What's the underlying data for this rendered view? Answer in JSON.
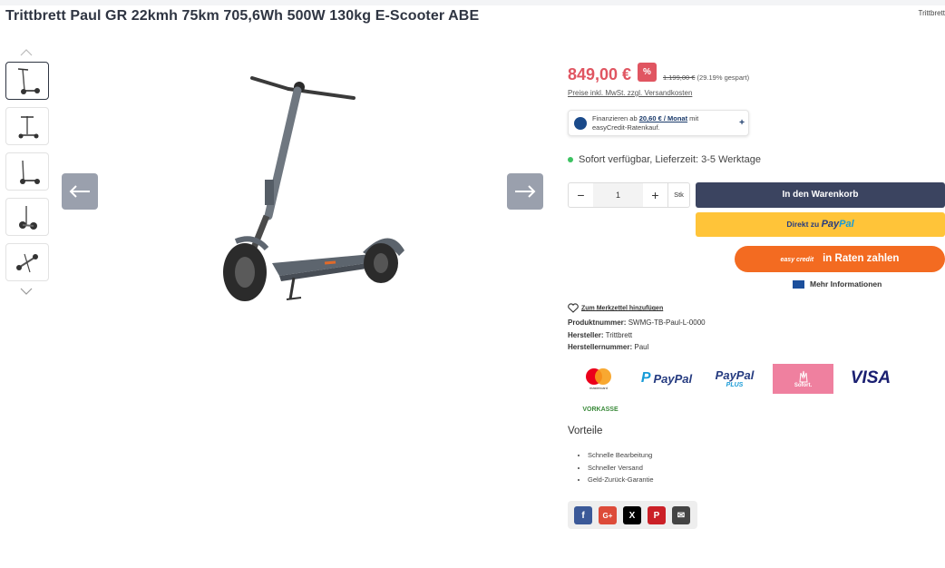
{
  "page": {
    "title": "Trittbrett Paul GR 22kmh 75km 705,6Wh 500W 130kg E-Scooter ABE",
    "brand_top": "Trittbrett"
  },
  "gallery": {
    "thumbnails": [
      "thumb-1",
      "thumb-2",
      "thumb-3",
      "thumb-4",
      "thumb-5"
    ],
    "active_index": 0
  },
  "buybox": {
    "price": "849,00 €",
    "badge": "%",
    "old_price": "1.199,00 €",
    "saving": "(29.19% gespart)",
    "tax_note": "Preise inkl. MwSt. zzgl. Versandkosten",
    "finance_prefix": "Finanzieren ab",
    "finance_rate": "20,60 € / Monat",
    "finance_with": "mit",
    "finance_suffix": "easyCredit-Ratenkauf.",
    "finance_plus": "+",
    "availability": "Sofort verfügbar, Lieferzeit: 3-5 Werktage",
    "qty_value": "1",
    "qty_minus": "−",
    "qty_plus": "+",
    "qty_unit": "Stk",
    "cart_label": "In den Warenkorb",
    "paypal_prefix": "Direkt zu",
    "paypal_pay": "Pay",
    "paypal_pal": "Pal",
    "raten_logo": "easy credit",
    "raten_label": "in Raten zahlen",
    "more_info": "Mehr Informationen"
  },
  "details": {
    "wishlist": "Zum Merkzettel hinzufügen",
    "product_number_label": "Produktnummer:",
    "product_number": "SWMG-TB-Paul-L-0000",
    "manufacturer_label": "Hersteller:",
    "manufacturer": "Trittbrett",
    "manufacturer_number_label": "Herstellernummer:",
    "manufacturer_number": "Paul"
  },
  "payments": {
    "mastercard": "mastercard",
    "paypal": "PayPal",
    "paypal_plus_1": "PayPal",
    "paypal_plus_2": "PLUS",
    "sofort": "Sofort.",
    "visa": "VISA",
    "vorkasse": "VORKASSE"
  },
  "vorteile": {
    "heading": "Vorteile",
    "items": [
      "Schnelle Bearbeitung",
      "Schneller Versand",
      "Geld-Zurück-Garantie"
    ]
  },
  "share": {
    "facebook": "f",
    "googleplus": "G+",
    "x": "X",
    "pinterest": "P",
    "mail": "✉"
  },
  "colors": {
    "price": "#e05561",
    "cart": "#3b4460",
    "paypal": "#ffc439",
    "raten": "#f36b21"
  }
}
